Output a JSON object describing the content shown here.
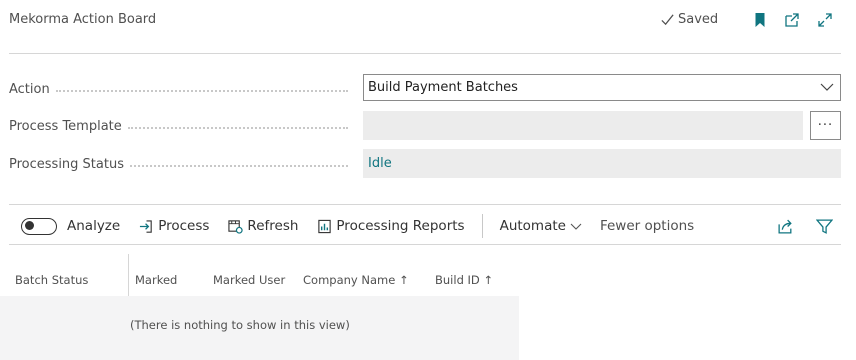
{
  "header": {
    "title": "Mekorma Action Board",
    "saved_label": "Saved",
    "icons": [
      "checkmark-icon",
      "bookmark-icon",
      "open-new-window-icon",
      "expand-icon"
    ]
  },
  "fields": {
    "action": {
      "label": "Action",
      "value": "Build Payment Batches"
    },
    "process_template": {
      "label": "Process Template",
      "value": "",
      "lookup_label": "···"
    },
    "processing_status": {
      "label": "Processing Status",
      "value": "Idle"
    }
  },
  "actionbar": {
    "analyze": "Analyze",
    "process": "Process",
    "refresh": "Refresh",
    "processing_reports": "Processing Reports",
    "automate": "Automate",
    "fewer_options": "Fewer options"
  },
  "grid": {
    "columns": [
      "Batch Status",
      "Marked",
      "Marked User",
      "Company Name ↑",
      "Build ID ↑"
    ],
    "empty_message": "(There is nothing to show in this view)"
  },
  "colors": {
    "accent": "#107580",
    "text": "#212121",
    "muted": "#505050"
  }
}
